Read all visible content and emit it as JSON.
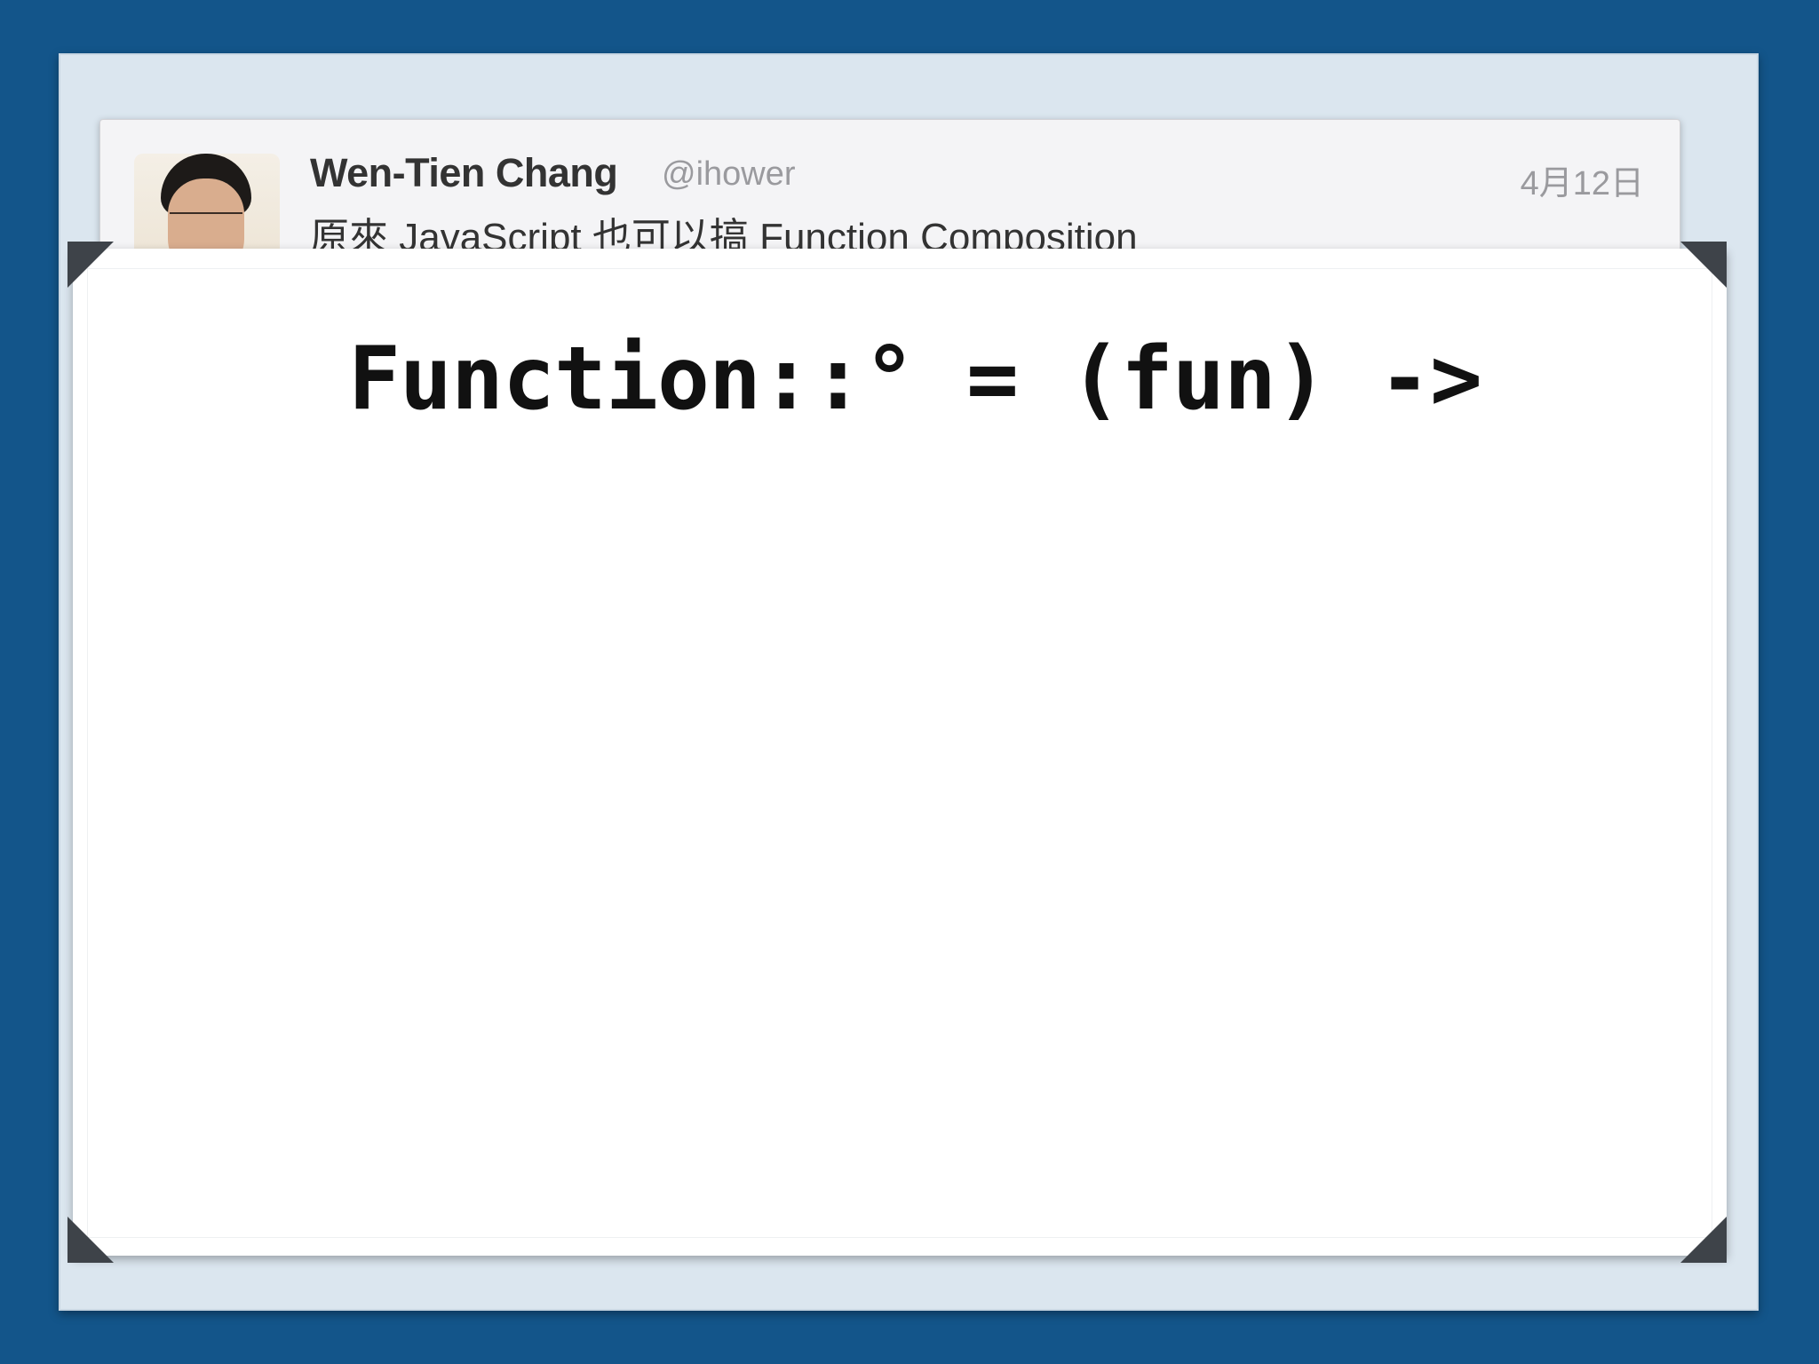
{
  "tweet": {
    "name": "Wen-Tien Chang",
    "handle": "@ihower",
    "date": "4月12日",
    "text": "原來 JavaScript 也可以搞 Function Composition"
  },
  "slide": {
    "code": "Function::° = (fun) ->"
  },
  "colors": {
    "background": "#13558a",
    "paper": "#dbe6ef",
    "slide": "#ffffff",
    "corner": "#3e4349"
  }
}
